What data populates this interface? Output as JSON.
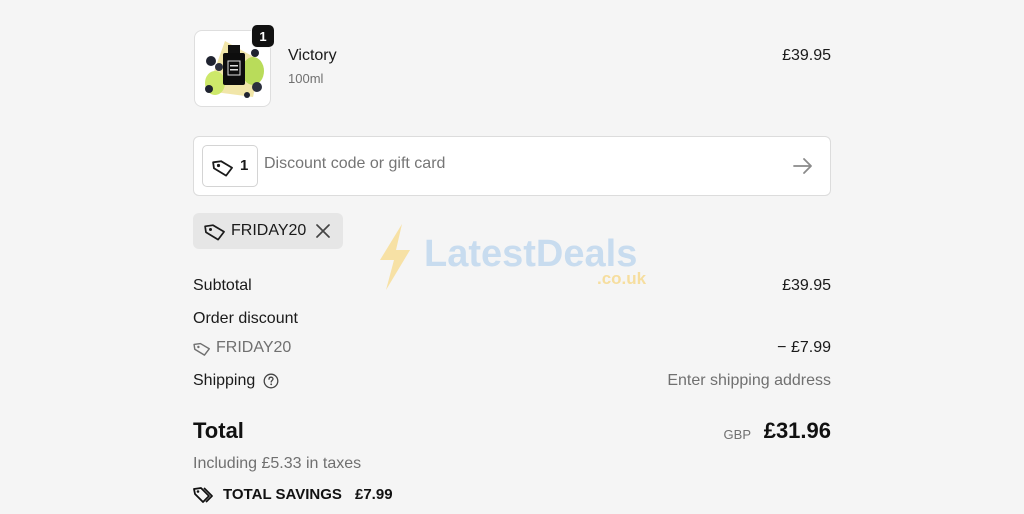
{
  "product": {
    "name": "Victory",
    "variant": "100ml",
    "price": "£39.95",
    "quantity": "1"
  },
  "discount_field": {
    "applied_count": "1",
    "placeholder": "Discount code or gift card",
    "value": ""
  },
  "applied_code": {
    "code": "FRIDAY20"
  },
  "watermark": {
    "brand": "LatestDeals",
    "domain": ".co.uk"
  },
  "summary": {
    "subtotal_label": "Subtotal",
    "subtotal_value": "£39.95",
    "order_discount_label": "Order discount",
    "discount_code": "FRIDAY20",
    "discount_value": "− £7.99",
    "shipping_label": "Shipping",
    "shipping_value": "Enter shipping address",
    "total_label": "Total",
    "currency": "GBP",
    "total_value": "£31.96",
    "taxes_text": "Including £5.33 in taxes",
    "savings_label": "TOTAL SAVINGS",
    "savings_value": "£7.99"
  },
  "colors": {
    "background": "#f5f5f5",
    "muted_text": "#707070",
    "badge": "#111111"
  },
  "icons": {
    "tag": "tag-icon",
    "arrow": "arrow-right-icon",
    "close": "close-icon",
    "help": "help-circle-icon",
    "savings": "tags-icon"
  }
}
